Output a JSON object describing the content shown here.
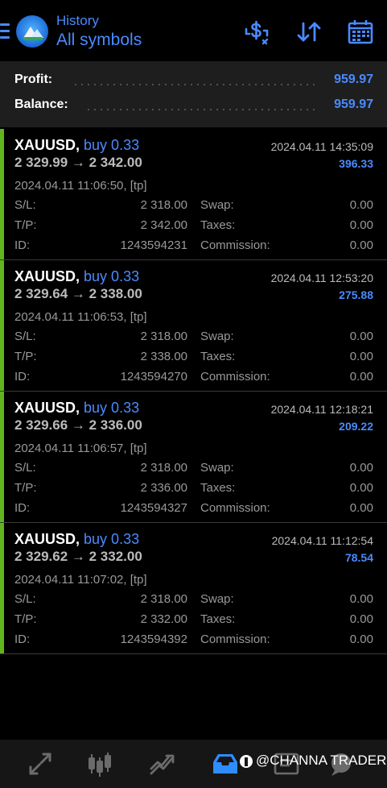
{
  "header": {
    "section": "History",
    "filter": "All symbols",
    "icons": [
      "menu-icon",
      "currency-exchange-icon",
      "sort-icon",
      "calendar-icon"
    ]
  },
  "summary": {
    "profit_label": "Profit:",
    "profit_value": "959.97",
    "balance_label": "Balance:",
    "balance_value": "959.97"
  },
  "labels": {
    "sl": "S/L:",
    "tp": "T/P:",
    "id": "ID:",
    "swap": "Swap:",
    "taxes": "Taxes:",
    "commission": "Commission:"
  },
  "trades": [
    {
      "symbol": "XAUUSD,",
      "side": "buy 0.33",
      "close_time": "2024.04.11 14:35:09",
      "prices": "2 329.99 → 2 342.00",
      "profit": "396.33",
      "open_info": "2024.04.11 11:06:50, [tp]",
      "sl": "2 318.00",
      "tp": "2 342.00",
      "id": "1243594231",
      "swap": "0.00",
      "taxes": "0.00",
      "commission": "0.00"
    },
    {
      "symbol": "XAUUSD,",
      "side": "buy 0.33",
      "close_time": "2024.04.11 12:53:20",
      "prices": "2 329.64 → 2 338.00",
      "profit": "275.88",
      "open_info": "2024.04.11 11:06:53, [tp]",
      "sl": "2 318.00",
      "tp": "2 338.00",
      "id": "1243594270",
      "swap": "0.00",
      "taxes": "0.00",
      "commission": "0.00"
    },
    {
      "symbol": "XAUUSD,",
      "side": "buy 0.33",
      "close_time": "2024.04.11 12:18:21",
      "prices": "2 329.66 → 2 336.00",
      "profit": "209.22",
      "open_info": "2024.04.11 11:06:57, [tp]",
      "sl": "2 318.00",
      "tp": "2 336.00",
      "id": "1243594327",
      "swap": "0.00",
      "taxes": "0.00",
      "commission": "0.00"
    },
    {
      "symbol": "XAUUSD,",
      "side": "buy 0.33",
      "close_time": "2024.04.11 11:12:54",
      "prices": "2 329.62 → 2 332.00",
      "profit": "78.54",
      "open_info": "2024.04.11 11:07:02, [tp]",
      "sl": "2 318.00",
      "tp": "2 332.00",
      "id": "1243594392",
      "swap": "0.00",
      "taxes": "0.00",
      "commission": "0.00"
    }
  ],
  "bottom_nav": {
    "icons": [
      "quotes-icon",
      "chart-icon",
      "trade-icon",
      "history-icon",
      "messages-icon",
      "settings-icon"
    ],
    "active": "history-icon"
  },
  "watermark": "@CHANNA TRADER",
  "colors": {
    "accent": "#4a8bff",
    "buy_bar": "#5fb51e",
    "summary_bg": "#1e1e1e"
  }
}
